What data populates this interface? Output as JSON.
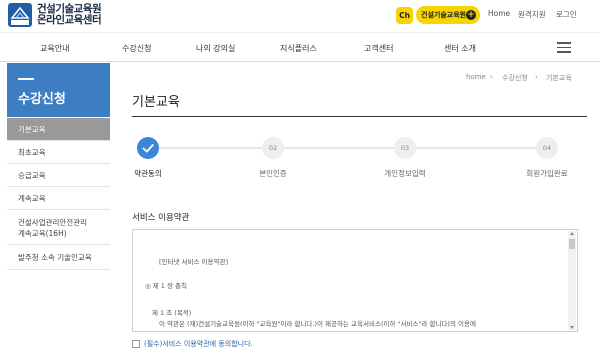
{
  "brand": {
    "line1": "건설기술교육원",
    "line2": "온라인교육센터",
    "mark_text": "KICTI",
    "color": "#1f5fa8"
  },
  "header": {
    "ch_badge": "Ch",
    "pill_label": "건설기술교육원",
    "pill_color": "#f6d500",
    "util_links": [
      "Home",
      "원격지원",
      "로그인"
    ]
  },
  "nav": {
    "items": [
      "교육안내",
      "수강신청",
      "나의 강의실",
      "지식플러스",
      "고객센터",
      "센터 소개"
    ]
  },
  "sidebar": {
    "title": "수강신청",
    "items": [
      {
        "label": "기본교육",
        "active": true
      },
      {
        "label": "최초교육",
        "active": false
      },
      {
        "label": "승급교육",
        "active": false
      },
      {
        "label": "계속교육",
        "active": false
      },
      {
        "label": "건설사업관리안전관리",
        "label2": "계속교육(16H)",
        "active": false
      },
      {
        "label": "발주청 소속 기술인교육",
        "active": false
      }
    ],
    "accent": "#3d7ec2"
  },
  "breadcrumb": [
    "home",
    "수강신청",
    "기본교육"
  ],
  "page_title": "기본교육",
  "steps": [
    {
      "number": "",
      "label": "약관동의",
      "done": true
    },
    {
      "number": "02",
      "label": "본인인증",
      "done": false
    },
    {
      "number": "03",
      "label": "개인정보입력",
      "done": false
    },
    {
      "number": "04",
      "label": "회원가입완료",
      "done": false
    }
  ],
  "terms": {
    "section_title": "서비스 이용약관",
    "lines": [
      "[인터넷 서비스 이용약관]",
      "◎ 제 1 장 총칙",
      "제 1 조 (목적)",
      "이 약관은 (재)건설기술교육원(이하 \"교육원\"이라 합니다.)이 제공하는 교육서비스(이하 \"서비스\"라 합니다)의 이용에"
    ],
    "agree_label": "(필수)서비스 이용약관에 동의합니다."
  }
}
